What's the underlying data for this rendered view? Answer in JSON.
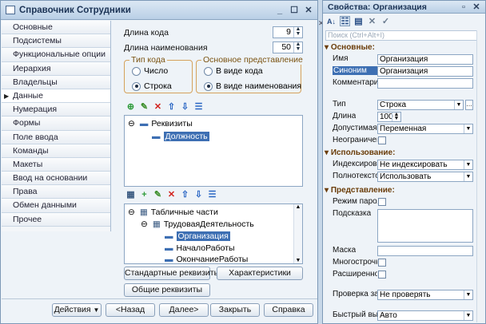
{
  "left_window": {
    "title": "Справочник Сотрудники",
    "sidebar": [
      "Основные",
      "Подсистемы",
      "Функциональные опции",
      "Иерархия",
      "Владельцы",
      "Данные",
      "Нумерация",
      "Формы",
      "Поле ввода",
      "Команды",
      "Макеты",
      "Ввод на основании",
      "Права",
      "Обмен данными",
      "Прочее"
    ],
    "active_item": "Данные",
    "code_length_label": "Длина кода",
    "code_length": "9",
    "name_length_label": "Длина наименования",
    "name_length": "50",
    "code_type_group": "Тип кода",
    "code_type_number": "Число",
    "code_type_string": "Строка",
    "main_repr_group": "Основное представление",
    "repr_as_code": "В виде кода",
    "repr_as_name": "В виде наименования",
    "attrs_root": "Реквизиты",
    "attrs_item": "Должность",
    "tables_root": "Табличные части",
    "table_name": "ТрудоваяДеятельность",
    "table_cols": [
      "Организация",
      "НачалоРаботы",
      "ОкончаниеРаботы"
    ],
    "btn_standard": "Стандартные реквизиты",
    "btn_characteristics": "Характеристики",
    "btn_common": "Общие реквизиты",
    "btn_actions": "Действия",
    "btn_back": "<Назад",
    "btn_next": "Далее>",
    "btn_close": "Закрыть",
    "btn_help": "Справка"
  },
  "right_window": {
    "title": "Свойства: Организация",
    "search_placeholder": "Поиск (Ctrl+Alt+I)",
    "section_basic": "Основные:",
    "name_label": "Имя",
    "name_value": "Организация",
    "synonym_label": "Синоним",
    "synonym_value": "Организация",
    "comment_label": "Комментарий",
    "type_label": "Тип",
    "type_value": "Строка",
    "length_label": "Длина",
    "length_value": "100",
    "allowed_len_label": "Допустимая д",
    "allowed_len_value": "Переменная",
    "unlimited_label": "Неограничен",
    "section_usage": "Использование:",
    "index_label": "Индексировать",
    "index_value": "Не индексировать",
    "fulltext_label": "Полнотекстов",
    "fulltext_value": "Использовать",
    "section_repr": "Представление:",
    "password_label": "Режим пароля",
    "tooltip_label": "Подсказка",
    "mask_label": "Маска",
    "multiline_label": "Многострочн",
    "extended_label": "Расширенное",
    "fill_check_label": "Проверка зап",
    "fill_check_value": "Не проверять",
    "quick_choice_label": "Быстрый выб",
    "quick_choice_value": "Авто"
  }
}
